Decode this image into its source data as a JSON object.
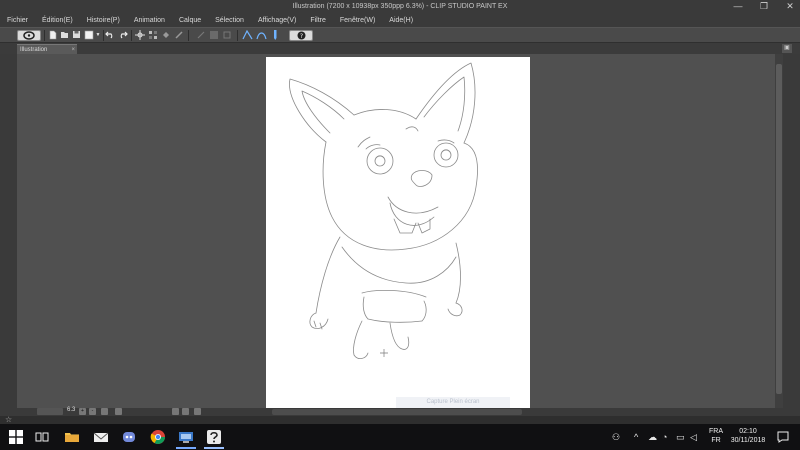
{
  "window": {
    "title": "Illustration (7200 x 10938px 350ppp 6.3%) - CLIP STUDIO PAINT EX",
    "controls": [
      "—",
      "❐",
      "✕"
    ]
  },
  "menu": [
    "Fichier",
    "Édition(E)",
    "Histoire(P)",
    "Animation",
    "Calque",
    "Sélection",
    "Affichage(V)",
    "Filtre",
    "Fenêtre(W)",
    "Aide(H)"
  ],
  "tabs": [
    {
      "label": "Illustration",
      "close": "×"
    }
  ],
  "status": {
    "zoom": "6.3"
  },
  "capture_label": "Capture Plein écran",
  "taskbar": {
    "lang_top": "FRA",
    "lang_bottom": "FR",
    "time": "02:10",
    "date": "30/11/2018"
  },
  "colors": {
    "canvas_bg": "#505050",
    "paper": "#ffffff",
    "lineart": "#8a8a8a",
    "taskbar": "#101012"
  }
}
